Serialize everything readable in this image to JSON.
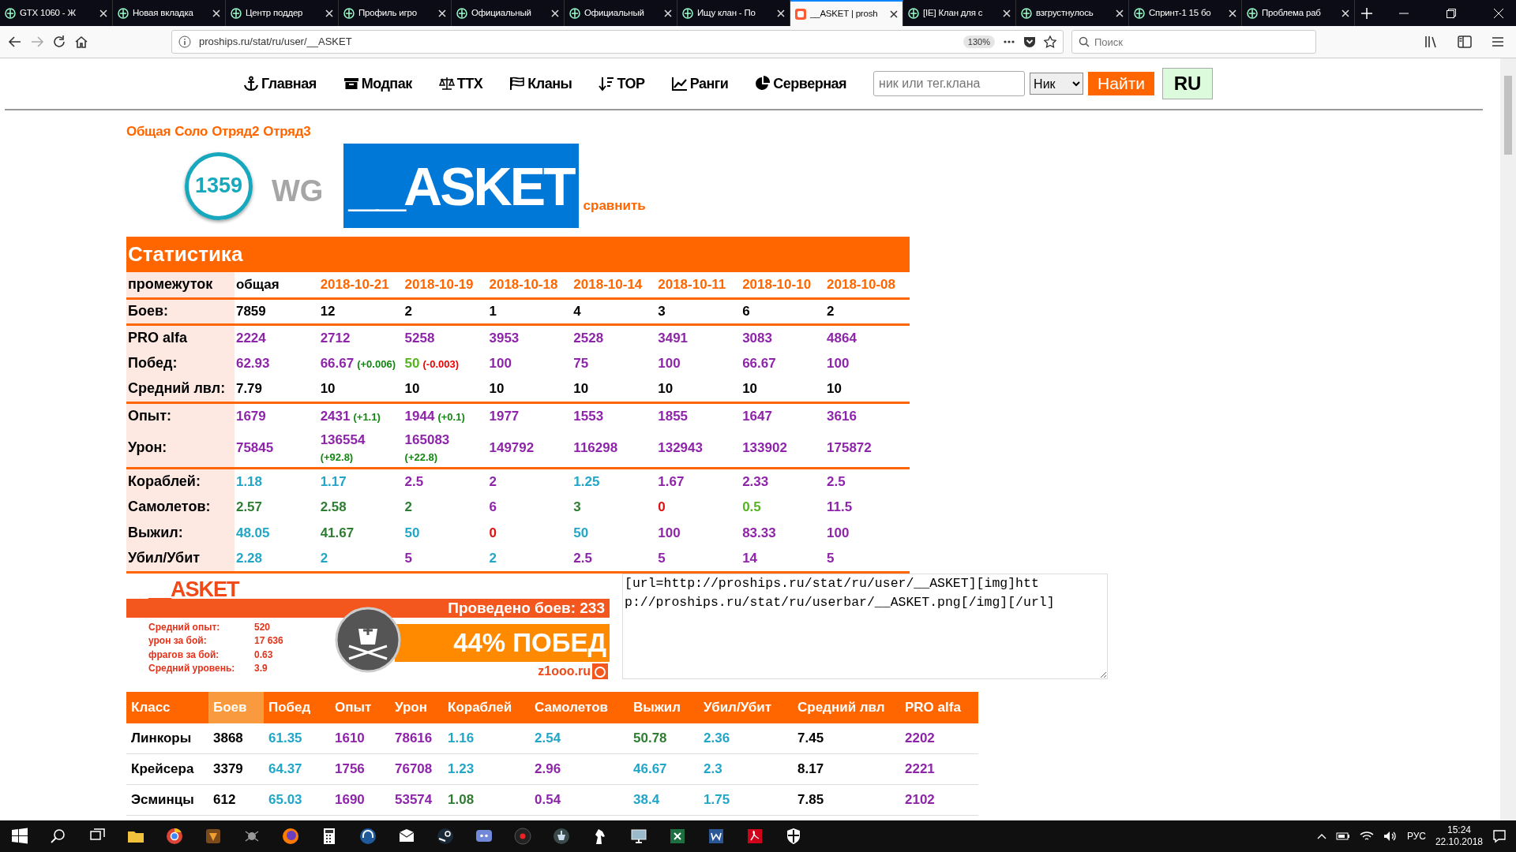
{
  "browser": {
    "tabs": [
      {
        "title": "GTX 1060 - Ж",
        "selected": false
      },
      {
        "title": "Новая вкладка",
        "selected": false
      },
      {
        "title": "Центр поддер",
        "selected": false
      },
      {
        "title": "Профиль игро",
        "selected": false
      },
      {
        "title": "Официальный",
        "selected": false
      },
      {
        "title": "Официальный",
        "selected": false
      },
      {
        "title": "Ищу клан - По",
        "selected": false
      },
      {
        "title": "__ASKET | prosh",
        "selected": true
      },
      {
        "title": "[IE] Клан для с",
        "selected": false
      },
      {
        "title": "взгрустнулось",
        "selected": false
      },
      {
        "title": "Спринт-1 15 бо",
        "selected": false
      },
      {
        "title": "Проблема раб",
        "selected": false
      }
    ],
    "address": "proships.ru/stat/ru/user/__ASKET",
    "zoom": "130%",
    "search_placeholder": "Поиск"
  },
  "nav": {
    "items": [
      "Главная",
      "Модпак",
      "ТТХ",
      "Кланы",
      "TOP",
      "Ранги",
      "Серверная"
    ],
    "search_placeholder": "ник или тег.клана",
    "mode": "Ник",
    "button": "Найти",
    "lang": "RU"
  },
  "mode_tabs": [
    "Общая",
    "Соло",
    "Отряд2",
    "Отряд3"
  ],
  "player": {
    "rating": "1359",
    "clan": "WG",
    "name": "__ASKET",
    "compare": "сравнить"
  },
  "stats": {
    "title": "Статистика",
    "header": {
      "label": "промежуток",
      "cells": [
        {
          "text": "общая",
          "color": "#000000"
        },
        {
          "text": "2018-10-21",
          "color": "#ff6600"
        },
        {
          "text": "2018-10-19",
          "color": "#ff6600"
        },
        {
          "text": "2018-10-18",
          "color": "#ff6600"
        },
        {
          "text": "2018-10-14",
          "color": "#ff6600"
        },
        {
          "text": "2018-10-11",
          "color": "#ff6600"
        },
        {
          "text": "2018-10-10",
          "color": "#ff6600"
        },
        {
          "text": "2018-10-08",
          "color": "#ff6600"
        }
      ]
    },
    "groups": [
      [
        {
          "label": "Боев:",
          "kind": "plain",
          "cells": [
            {
              "text": "7859",
              "color": "#000000"
            },
            {
              "text": "12",
              "color": "#000000"
            },
            {
              "text": "2",
              "color": "#000000"
            },
            {
              "text": "1",
              "color": "#000000"
            },
            {
              "text": "4",
              "color": "#000000"
            },
            {
              "text": "3",
              "color": "#000000"
            },
            {
              "text": "6",
              "color": "#000000"
            },
            {
              "text": "2",
              "color": "#000000"
            }
          ]
        }
      ],
      [
        {
          "label": "PRO alfa",
          "kind": "plain",
          "cells": [
            {
              "text": "2224",
              "color": "#8e24aa"
            },
            {
              "text": "2712",
              "color": "#8e24aa"
            },
            {
              "text": "5258",
              "color": "#8e24aa"
            },
            {
              "text": "3953",
              "color": "#8e24aa"
            },
            {
              "text": "2528",
              "color": "#8e24aa"
            },
            {
              "text": "3491",
              "color": "#8e24aa"
            },
            {
              "text": "3083",
              "color": "#8e24aa"
            },
            {
              "text": "4864",
              "color": "#8e24aa"
            }
          ]
        },
        {
          "label": "Побед:",
          "kind": "plain",
          "cells": [
            {
              "text": "62.93",
              "color": "#8e24aa"
            },
            {
              "text": "66.67",
              "color": "#8e24aa",
              "delta": {
                "text": "(+0.006)",
                "color": "#118811"
              }
            },
            {
              "text": "50",
              "color": "#55b322",
              "delta": {
                "text": "(-0.003)",
                "color": "#ee0000"
              }
            },
            {
              "text": "100",
              "color": "#8e24aa"
            },
            {
              "text": "75",
              "color": "#8e24aa"
            },
            {
              "text": "100",
              "color": "#8e24aa"
            },
            {
              "text": "66.67",
              "color": "#8e24aa"
            },
            {
              "text": "100",
              "color": "#8e24aa"
            }
          ]
        },
        {
          "label": "Средний лвл:",
          "kind": "plain",
          "cells": [
            {
              "text": "7.79",
              "color": "#000000"
            },
            {
              "text": "10",
              "color": "#000000"
            },
            {
              "text": "10",
              "color": "#000000"
            },
            {
              "text": "10",
              "color": "#000000"
            },
            {
              "text": "10",
              "color": "#000000"
            },
            {
              "text": "10",
              "color": "#000000"
            },
            {
              "text": "10",
              "color": "#000000"
            },
            {
              "text": "10",
              "color": "#000000"
            }
          ]
        }
      ],
      [
        {
          "label": "Опыт:",
          "kind": "plain",
          "cells": [
            {
              "text": "1679",
              "color": "#8e24aa"
            },
            {
              "text": "2431",
              "color": "#8e24aa",
              "delta": {
                "text": "(+1.1)",
                "color": "#118811"
              }
            },
            {
              "text": "1944",
              "color": "#8e24aa",
              "delta": {
                "text": "(+0.1)",
                "color": "#118811"
              }
            },
            {
              "text": "1977",
              "color": "#8e24aa"
            },
            {
              "text": "1553",
              "color": "#8e24aa"
            },
            {
              "text": "1855",
              "color": "#8e24aa"
            },
            {
              "text": "1647",
              "color": "#8e24aa"
            },
            {
              "text": "3616",
              "color": "#8e24aa"
            }
          ]
        },
        {
          "label": "Урон:",
          "kind": "wrapped",
          "cells": [
            {
              "text": "75845",
              "color": "#8e24aa"
            },
            {
              "text": "136554",
              "color": "#8e24aa",
              "delta": {
                "text": "(+92.8)",
                "color": "#118811"
              }
            },
            {
              "text": "165083",
              "color": "#8e24aa",
              "delta": {
                "text": "(+22.8)",
                "color": "#118811"
              }
            },
            {
              "text": "149792",
              "color": "#8e24aa"
            },
            {
              "text": "116298",
              "color": "#8e24aa"
            },
            {
              "text": "132943",
              "color": "#8e24aa"
            },
            {
              "text": "133902",
              "color": "#8e24aa"
            },
            {
              "text": "175872",
              "color": "#8e24aa"
            }
          ]
        }
      ],
      [
        {
          "label": "Кораблей:",
          "kind": "plain",
          "cells": [
            {
              "text": "1.18",
              "color": "#22a6c8"
            },
            {
              "text": "1.17",
              "color": "#22a6c8"
            },
            {
              "text": "2.5",
              "color": "#8e24aa"
            },
            {
              "text": "2",
              "color": "#8e24aa"
            },
            {
              "text": "1.25",
              "color": "#22a6c8"
            },
            {
              "text": "1.67",
              "color": "#8e24aa"
            },
            {
              "text": "2.33",
              "color": "#8e24aa"
            },
            {
              "text": "2.5",
              "color": "#8e24aa"
            }
          ]
        },
        {
          "label": "Самолетов:",
          "kind": "plain",
          "cells": [
            {
              "text": "2.57",
              "color": "#2e7d32"
            },
            {
              "text": "2.58",
              "color": "#2e7d32"
            },
            {
              "text": "2",
              "color": "#2e7d32"
            },
            {
              "text": "6",
              "color": "#8e24aa"
            },
            {
              "text": "3",
              "color": "#2e7d32"
            },
            {
              "text": "0",
              "color": "#dd1111"
            },
            {
              "text": "0.5",
              "color": "#55b322"
            },
            {
              "text": "11.5",
              "color": "#8e24aa"
            }
          ]
        },
        {
          "label": "Выжил:",
          "kind": "plain",
          "cells": [
            {
              "text": "48.05",
              "color": "#22a6c8"
            },
            {
              "text": "41.67",
              "color": "#2e7d32"
            },
            {
              "text": "50",
              "color": "#22a6c8"
            },
            {
              "text": "0",
              "color": "#dd1111"
            },
            {
              "text": "50",
              "color": "#22a6c8"
            },
            {
              "text": "100",
              "color": "#8e24aa"
            },
            {
              "text": "83.33",
              "color": "#8e24aa"
            },
            {
              "text": "100",
              "color": "#8e24aa"
            }
          ]
        },
        {
          "label": "Убил/Убит",
          "kind": "plain",
          "cells": [
            {
              "text": "2.28",
              "color": "#22a6c8"
            },
            {
              "text": "2",
              "color": "#22a6c8"
            },
            {
              "text": "5",
              "color": "#8e24aa"
            },
            {
              "text": "2",
              "color": "#22a6c8"
            },
            {
              "text": "2.5",
              "color": "#8e24aa"
            },
            {
              "text": "5",
              "color": "#8e24aa"
            },
            {
              "text": "14",
              "color": "#8e24aa"
            },
            {
              "text": "5",
              "color": "#8e24aa"
            }
          ]
        }
      ]
    ]
  },
  "userbar": {
    "name": "__ASKET",
    "battles": "Проведено боев: 233",
    "lines": [
      {
        "label": "Средний опыт:",
        "value": "520"
      },
      {
        "label": "урон за бой:",
        "value": "17 636"
      },
      {
        "label": "фрагов за бой:",
        "value": "0.63"
      },
      {
        "label": "Средний уровень:",
        "value": "3.9"
      }
    ],
    "wins": "44% ПОБЕД",
    "site": "z1ooo.ru"
  },
  "bbcode": "[url=http://proships.ru/stat/ru/user/__ASKET][img]http://proships.ru/stat/ru/userbar/__ASKET.png[/img][/url]",
  "class_table": {
    "columns": [
      {
        "label": "Класс",
        "selected": false
      },
      {
        "label": "Боев",
        "selected": true
      },
      {
        "label": "Побед",
        "selected": false
      },
      {
        "label": "Опыт",
        "selected": false
      },
      {
        "label": "Урон",
        "selected": false
      },
      {
        "label": "Кораблей",
        "selected": false
      },
      {
        "label": "Самолетов",
        "selected": false
      },
      {
        "label": "Выжил",
        "selected": false
      },
      {
        "label": "Убил/Убит",
        "selected": false
      },
      {
        "label": "Средний лвл",
        "selected": false
      },
      {
        "label": "PRO alfa",
        "selected": false
      }
    ],
    "rows": [
      [
        {
          "text": "Линкоры",
          "color": "#000000"
        },
        {
          "text": "3868",
          "color": "#000000"
        },
        {
          "text": "61.35",
          "color": "#22a6c8"
        },
        {
          "text": "1610",
          "color": "#8e24aa"
        },
        {
          "text": "78616",
          "color": "#8e24aa"
        },
        {
          "text": "1.16",
          "color": "#22a6c8"
        },
        {
          "text": "2.54",
          "color": "#22a6c8"
        },
        {
          "text": "50.78",
          "color": "#2e7d32"
        },
        {
          "text": "2.36",
          "color": "#22a6c8"
        },
        {
          "text": "7.45",
          "color": "#000000"
        },
        {
          "text": "2202",
          "color": "#8e24aa"
        }
      ],
      [
        {
          "text": "Крейсера",
          "color": "#000000"
        },
        {
          "text": "3379",
          "color": "#000000"
        },
        {
          "text": "64.37",
          "color": "#22a6c8"
        },
        {
          "text": "1756",
          "color": "#8e24aa"
        },
        {
          "text": "76708",
          "color": "#8e24aa"
        },
        {
          "text": "1.23",
          "color": "#22a6c8"
        },
        {
          "text": "2.96",
          "color": "#8e24aa"
        },
        {
          "text": "46.67",
          "color": "#22a6c8"
        },
        {
          "text": "2.3",
          "color": "#22a6c8"
        },
        {
          "text": "8.17",
          "color": "#000000"
        },
        {
          "text": "2221",
          "color": "#8e24aa"
        }
      ],
      [
        {
          "text": "Эсминцы",
          "color": "#000000"
        },
        {
          "text": "612",
          "color": "#000000"
        },
        {
          "text": "65.03",
          "color": "#22a6c8"
        },
        {
          "text": "1690",
          "color": "#8e24aa"
        },
        {
          "text": "53574",
          "color": "#8e24aa"
        },
        {
          "text": "1.08",
          "color": "#2e7d32"
        },
        {
          "text": "0.54",
          "color": "#8e24aa"
        },
        {
          "text": "38.4",
          "color": "#22a6c8"
        },
        {
          "text": "1.75",
          "color": "#22a6c8"
        },
        {
          "text": "7.85",
          "color": "#000000"
        },
        {
          "text": "2102",
          "color": "#8e24aa"
        }
      ]
    ]
  },
  "taskbar": {
    "language": "РУС",
    "time": "15:24",
    "date": "22.10.2018"
  }
}
